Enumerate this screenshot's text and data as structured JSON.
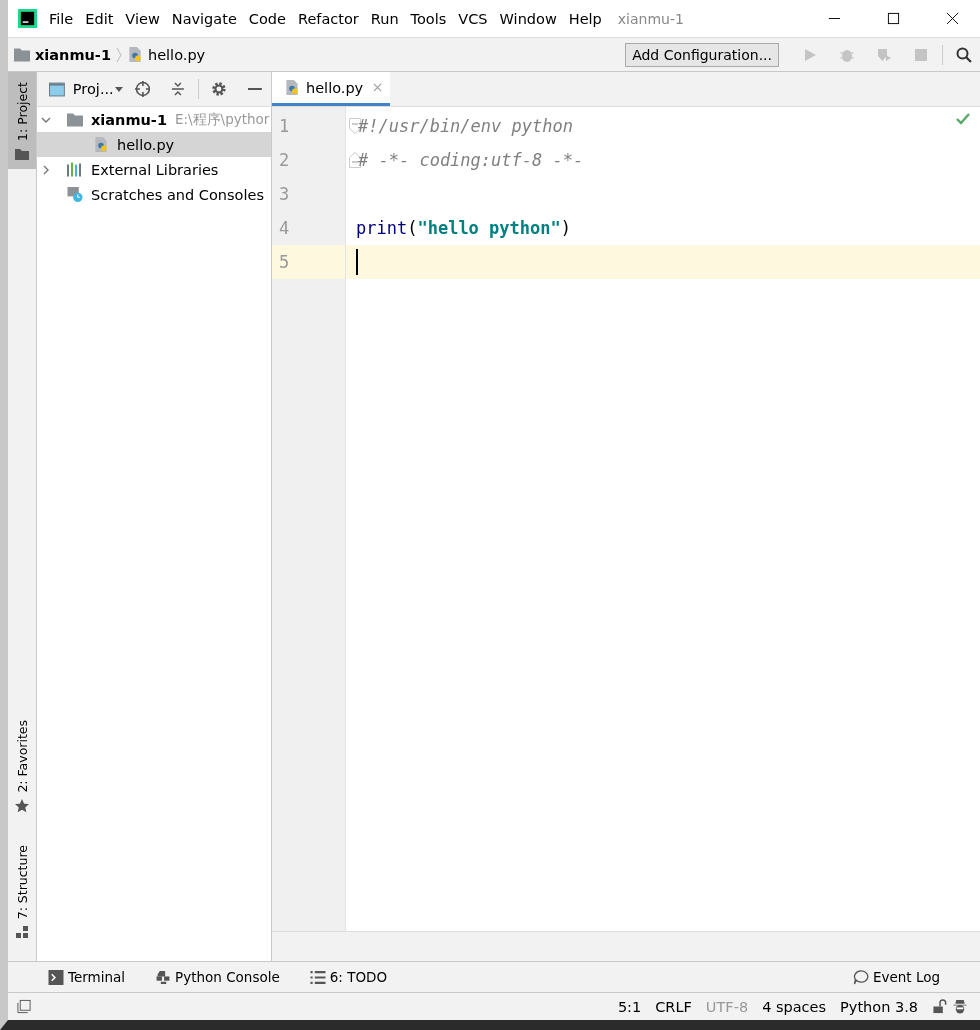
{
  "window": {
    "title": "xianmu-1",
    "menu": [
      "File",
      "Edit",
      "View",
      "Navigate",
      "Code",
      "Refactor",
      "Run",
      "Tools",
      "VCS",
      "Window",
      "Help"
    ]
  },
  "breadcrumbs": [
    "xianmu-1",
    "hello.py"
  ],
  "toolbar": {
    "run_config": "Add Configuration..."
  },
  "side_tabs_top": [
    {
      "label": "1: Project",
      "selected": true
    }
  ],
  "side_tabs_bottom": [
    {
      "label": "2: Favorites",
      "kind": "star"
    },
    {
      "label": "7: Structure",
      "kind": "structure"
    }
  ],
  "project_panel": {
    "title": "Proj...",
    "tree": [
      {
        "label": "xianmu-1",
        "path": "E:\\程序\\pythor",
        "kind": "folder",
        "expanded": true,
        "selected": false,
        "children": [
          {
            "label": "hello.py",
            "kind": "python",
            "selected": true
          }
        ]
      },
      {
        "label": "External Libraries",
        "kind": "libraries",
        "expanded": false,
        "selected": false
      },
      {
        "label": "Scratches and Consoles",
        "kind": "scratches",
        "selected": false
      }
    ]
  },
  "editor": {
    "tabs": [
      {
        "label": "hello.py",
        "selected": true
      }
    ],
    "lines": [
      {
        "number": "1",
        "current": false,
        "kind": "fold_start",
        "tokens": [
          {
            "text": "#!/usr/bin/env python",
            "kind": "comment"
          }
        ]
      },
      {
        "number": "2",
        "current": false,
        "kind": "fold_end",
        "tokens": [
          {
            "text": "# -*- coding:utf-8 -*-",
            "kind": "comment"
          }
        ]
      },
      {
        "number": "3",
        "current": false,
        "kind": "plain"
      },
      {
        "number": "4",
        "current": false,
        "kind": "plain",
        "tokens": [
          {
            "text": "print",
            "kind": "builtin"
          },
          {
            "text": "(",
            "kind": "plain"
          },
          {
            "text": "\"hello python\"",
            "kind": "string"
          },
          {
            "text": ")",
            "kind": "plain"
          }
        ]
      },
      {
        "number": "5",
        "current": true,
        "kind": "plain"
      }
    ]
  },
  "tool_windows": [
    {
      "label": "Terminal",
      "kind": "terminal"
    },
    {
      "label": "Python Console",
      "kind": "python"
    },
    {
      "label": "6: TODO",
      "kind": "todo"
    }
  ],
  "event_log": "Event Log",
  "status_bar": [
    {
      "text": "5:1",
      "disabled": false
    },
    {
      "text": "CRLF",
      "disabled": false
    },
    {
      "text": "UTF-8",
      "disabled": true
    },
    {
      "text": "4 spaces",
      "disabled": false
    },
    {
      "text": "Python 3.8",
      "disabled": false
    }
  ]
}
